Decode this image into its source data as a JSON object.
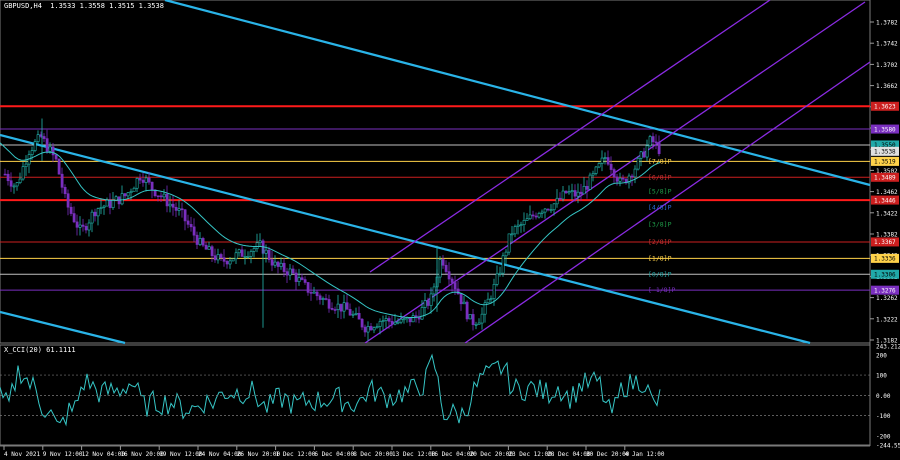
{
  "header": {
    "symbol": "GBPUSD,H4",
    "ohlc": "1.3533 1.3558 1.3515 1.3538"
  },
  "price_axis": {
    "ticks": [
      "1.3782",
      "1.3742",
      "1.3702",
      "1.3662",
      "1.3622",
      "1.3582",
      "1.3542",
      "1.3502",
      "1.3462",
      "1.3422",
      "1.3382",
      "1.3342",
      "1.3302",
      "1.3262",
      "1.3222",
      "1.3182"
    ],
    "tags": [
      {
        "text": "1.3623",
        "bg": "#cc1f1f",
        "fg": "#ffffff"
      },
      {
        "text": "1.3580",
        "bg": "#7a2fbf",
        "fg": "#ffffff"
      },
      {
        "text": "1.3550",
        "bg": "#20a8a8",
        "fg": "#000000"
      },
      {
        "text": "1.3538",
        "bg": "#e0e0e0",
        "fg": "#000000"
      },
      {
        "text": "1.3519",
        "bg": "#ffd24a",
        "fg": "#000000"
      },
      {
        "text": "1.3489",
        "bg": "#cc1f1f",
        "fg": "#ffffff"
      },
      {
        "text": "1.3446",
        "bg": "#cc1f1f",
        "fg": "#ffffff"
      },
      {
        "text": "1.3367",
        "bg": "#cc1f1f",
        "fg": "#ffffff"
      },
      {
        "text": "1.3336",
        "bg": "#ffd24a",
        "fg": "#000000"
      },
      {
        "text": "1.3306",
        "bg": "#20a8a8",
        "fg": "#000000"
      },
      {
        "text": "1.3276",
        "bg": "#7a2fbf",
        "fg": "#ffffff"
      }
    ]
  },
  "murrey_labels": [
    {
      "text": "[7/8]P",
      "color": "#ffd24a"
    },
    {
      "text": "[6/8]P",
      "color": "#cc3333"
    },
    {
      "text": "[5/8]P",
      "color": "#1f9f4a"
    },
    {
      "text": "[4/8]P",
      "color": "#2a6fdf"
    },
    {
      "text": "[3/8]P",
      "color": "#1f9f4a"
    },
    {
      "text": "[2/8]P",
      "color": "#cc3333"
    },
    {
      "text": "[1/8]P",
      "color": "#ffd24a"
    },
    {
      "text": "[0/8]P",
      "color": "#20a8a8"
    },
    {
      "text": "[-1/8]P",
      "color": "#7a2fbf"
    }
  ],
  "indicator": {
    "label": "X_CCI(20) 61.1111",
    "ticks": [
      "243.2126",
      "200",
      "100",
      "0.00",
      "-100",
      "-200",
      "-244.555"
    ]
  },
  "time_axis": [
    "4 Nov 2021",
    "9 Nov 12:00",
    "12 Nov 04:00",
    "16 Nov 20:00",
    "19 Nov 12:00",
    "24 Nov 04:00",
    "26 Nov 20:00",
    "1 Dec 12:00",
    "6 Dec 04:00",
    "8 Dec 20:00",
    "13 Dec 12:00",
    "16 Dec 04:00",
    "20 Dec 20:00",
    "23 Dec 12:00",
    "28 Dec 04:00",
    "30 Dec 20:00",
    "4 Jan 12:00"
  ],
  "colors": {
    "bg": "#000000",
    "candle": "#22b8b0",
    "candle_alt": "#7a2fbf",
    "ma": "#36c6c6",
    "trend": "#2ab4e8",
    "channel": "#8a2be2",
    "red_level": "#ff1a1a",
    "cci": "#36c6c6"
  }
}
